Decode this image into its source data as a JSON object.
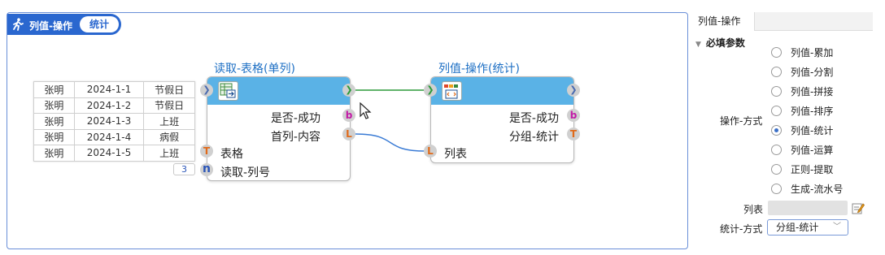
{
  "canvas": {
    "title": "列值-操作",
    "badge": "统计"
  },
  "data_table": {
    "rows": [
      [
        "张明",
        "2024-1-1",
        "节假日"
      ],
      [
        "张明",
        "2024-1-2",
        "节假日"
      ],
      [
        "张明",
        "2024-1-3",
        "上班"
      ],
      [
        "张明",
        "2024-1-4",
        "病假"
      ],
      [
        "张明",
        "2024-1-5",
        "上班"
      ]
    ]
  },
  "node_read": {
    "title": "读取-表格(单列)",
    "out_success": "是否-成功",
    "out_first": "首列-内容",
    "in_table": "表格",
    "in_column": "读取-列号",
    "column_value": "3",
    "port_b": "b",
    "port_L": "L",
    "port_T": "T",
    "port_n": "n"
  },
  "node_stat": {
    "title": "列值-操作(统计)",
    "out_success": "是否-成功",
    "out_group": "分组-统计",
    "in_list": "列表",
    "port_b": "b",
    "port_T": "T",
    "port_L": "L"
  },
  "panel": {
    "tab": "列值-操作",
    "section": "必填参数",
    "operation_label": "操作-方式",
    "options": [
      "列值-累加",
      "列值-分割",
      "列值-拼接",
      "列值-排序",
      "列值-统计",
      "列值-运算",
      "正则-提取",
      "生成-流水号"
    ],
    "selected_option": "列值-统计",
    "list_label": "列表",
    "stat_label": "统计-方式",
    "stat_value": "分组-统计"
  },
  "colors": {
    "accent": "#2a67cf",
    "node_header": "#5ab2e6",
    "node_title": "#1d6fc4",
    "link_green": "#2b9a3a",
    "link_blue": "#3a7bd5"
  }
}
